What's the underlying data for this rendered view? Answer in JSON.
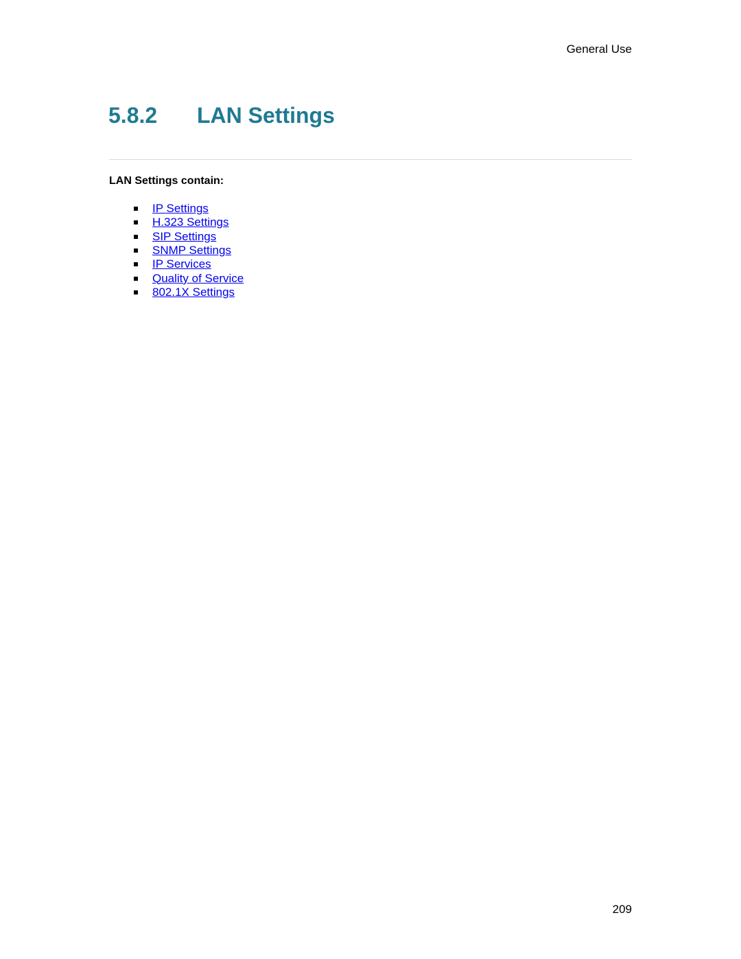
{
  "header": {
    "section_label": "General Use"
  },
  "heading": {
    "number": "5.8.2",
    "title": "LAN Settings"
  },
  "intro": "LAN Settings contain:",
  "links": [
    {
      "label": "IP Settings"
    },
    {
      "label": "H.323 Settings"
    },
    {
      "label": "SIP Settings"
    },
    {
      "label": "SNMP Settings"
    },
    {
      "label": "IP Services"
    },
    {
      "label": "Quality of Service"
    },
    {
      "label": "802.1X Settings"
    }
  ],
  "footer": {
    "page_number": "209"
  },
  "colors": {
    "heading": "#1f7a92",
    "link": "#0000ee"
  }
}
